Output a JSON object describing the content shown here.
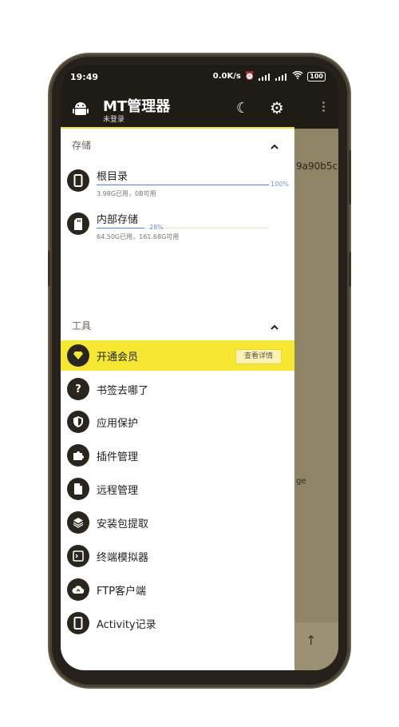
{
  "status_bar": {
    "time": "19:49",
    "network_speed": "0.0K/s",
    "signal_1": "HD",
    "signal_2": "HD",
    "battery": "100"
  },
  "toolbar": {
    "title": "MT管理器",
    "subtitle": "未登录"
  },
  "background_panel": {
    "hash_text": "9a90b5c",
    "partial_text": "ge"
  },
  "drawer": {
    "storage_section": "存储",
    "storage": [
      {
        "label": "根目录",
        "percent_label": "100%",
        "percent": 100,
        "usage": "3.98G已用，0B可用",
        "icon": "phone-icon"
      },
      {
        "label": "内部存储",
        "percent_label": "28%",
        "percent": 28,
        "usage": "64.50G已用，161.68G可用",
        "icon": "sdcard-icon"
      }
    ],
    "tools_section": "工具",
    "vip": {
      "label": "开通会员",
      "button": "查看详情",
      "icon": "diamond-icon"
    },
    "tools": [
      {
        "label": "书签去哪了",
        "icon": "question-icon"
      },
      {
        "label": "应用保护",
        "icon": "shield-icon"
      },
      {
        "label": "插件管理",
        "icon": "puzzle-icon"
      },
      {
        "label": "远程管理",
        "icon": "file-icon"
      },
      {
        "label": "安装包提取",
        "icon": "layers-icon"
      },
      {
        "label": "终端模拟器",
        "icon": "terminal-icon"
      },
      {
        "label": "FTP客户端",
        "icon": "cloud-icon"
      },
      {
        "label": "Activity记录",
        "icon": "phone-outline-icon"
      }
    ]
  },
  "colors": {
    "accent": "#f6e733",
    "toolbar": "#1f1b15",
    "progress": "#4d86e6"
  }
}
